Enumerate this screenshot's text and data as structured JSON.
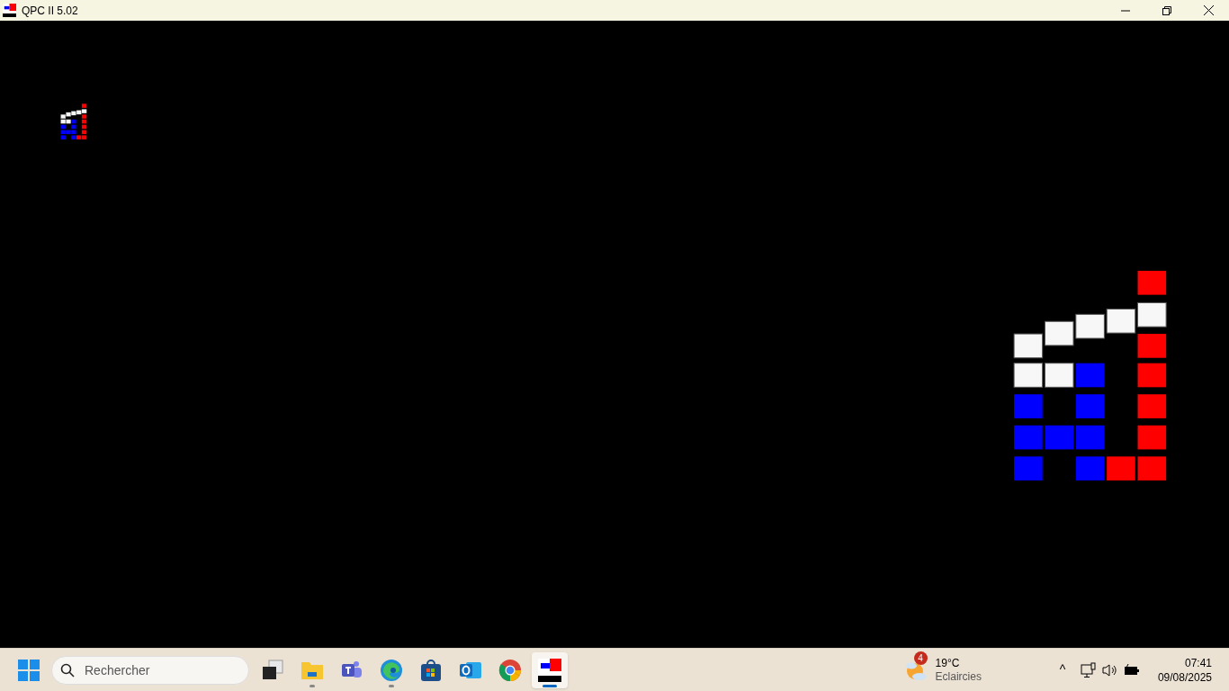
{
  "window": {
    "title": "QPC II 5.02"
  },
  "taskbar": {
    "search": {
      "placeholder": "Rechercher"
    },
    "apps": [
      {
        "kind": "taskview",
        "running": false,
        "selected": false
      },
      {
        "kind": "folder",
        "running": true,
        "selected": false
      },
      {
        "kind": "teams",
        "running": false,
        "selected": false
      },
      {
        "kind": "edge",
        "running": true,
        "selected": false
      },
      {
        "kind": "store",
        "running": false,
        "selected": false
      },
      {
        "kind": "outlook",
        "running": false,
        "selected": false
      },
      {
        "kind": "chrome",
        "running": false,
        "selected": false
      },
      {
        "kind": "qpc",
        "running": true,
        "selected": true
      }
    ],
    "weather": {
      "badge": "4",
      "temperature": "19°C",
      "condition": "Eclaircies"
    },
    "tray": {
      "chevron": "^"
    },
    "clock": {
      "time": "07:41",
      "date": "09/08/2025"
    }
  }
}
